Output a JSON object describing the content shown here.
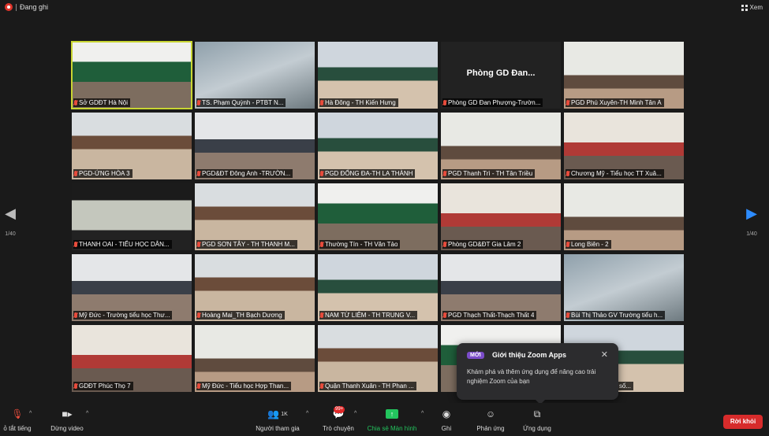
{
  "recording": {
    "label": "Đang ghi"
  },
  "view": {
    "label": "Xem"
  },
  "pagination": {
    "left": "1/40",
    "right": "1/40"
  },
  "tiles": [
    {
      "label": "Sở GDĐT Hà Nội",
      "active": true,
      "bg": "bg3"
    },
    {
      "label": "TS. Phạm Quỳnh - PTBT N...",
      "bg": "bg6"
    },
    {
      "label": "Hà Đông - TH Kiến Hưng",
      "bg": "bg5"
    },
    {
      "label": "Phòng GD Đan Phượng-Trườn...",
      "avatar": "Phòng GD Đan..."
    },
    {
      "label": "PGD Phú Xuyên-TH Minh Tân A",
      "bg": "bg8"
    },
    {
      "label": "PGD-ỨNG HÒA 3",
      "bg": "bg1"
    },
    {
      "label": "PGD&ĐT Đông Anh -TRƯỜN...",
      "bg": "bg2"
    },
    {
      "label": "PGD ĐỐNG ĐA-TH LA THÀNH",
      "bg": "bg5"
    },
    {
      "label": "PGD Thanh Trì - TH Tân Triều",
      "bg": "bg8"
    },
    {
      "label": "Chương Mỹ - Tiểu học TT Xuâ...",
      "bg": "bg4"
    },
    {
      "label": "THANH OAI - TIỂU HỌC DÂN...",
      "bg": "bg7"
    },
    {
      "label": "PGD SƠN TÂY - TH THANH M...",
      "bg": "bg1"
    },
    {
      "label": "Thường Tín - TH Văn Tảo",
      "bg": "bg3"
    },
    {
      "label": "Phòng GD&ĐT Gia Lâm 2",
      "bg": "bg4"
    },
    {
      "label": "Long Biên - 2",
      "bg": "bg8"
    },
    {
      "label": "Mỹ Đức - Trường tiểu học Thư...",
      "bg": "bg2"
    },
    {
      "label": "Hoàng Mai_TH Bạch Dương",
      "bg": "bg1"
    },
    {
      "label": "NAM TỪ LIÊM - TH TRUNG V...",
      "bg": "bg5"
    },
    {
      "label": "PGD Thạch Thất-Thạch Thất 4",
      "bg": "bg2"
    },
    {
      "label": "Bùi Thị Thảo GV Trường tiểu h...",
      "bg": "bg6"
    },
    {
      "label": "GDĐT Phúc Thọ 7",
      "bg": "bg4"
    },
    {
      "label": "Mỹ Đức - Tiểu học Hợp Than...",
      "bg": "bg8"
    },
    {
      "label": "Quận Thanh Xuân - TH Phan ...",
      "bg": "bg1"
    },
    {
      "label": "",
      "bg": "bg3"
    },
    {
      "label": "...hất - Điềm cầu số...",
      "bg": "bg5"
    }
  ],
  "popup": {
    "badge": "MỚI",
    "title": "Giới thiệu Zoom Apps",
    "body": "Khám phá và thêm ứng dụng để nâng cao trải nghiệm Zoom của bạn"
  },
  "toolbar": {
    "mute": "ỏ tắt tiếng",
    "video": "Dừng video",
    "participants": "Người tham gia",
    "participants_count": "1K",
    "chat": "Trò chuyện",
    "chat_badge": "99+",
    "share": "Chia sẻ Màn hình",
    "record": "Ghi",
    "reactions": "Phản ứng",
    "apps": "Ứng dụng",
    "leave": "Rời khỏi"
  },
  "colors": {
    "share_green": "#23c55e",
    "leave_red": "#d72b2b",
    "active_border": "#c8d532",
    "badge_purple": "#7b4cc9"
  }
}
